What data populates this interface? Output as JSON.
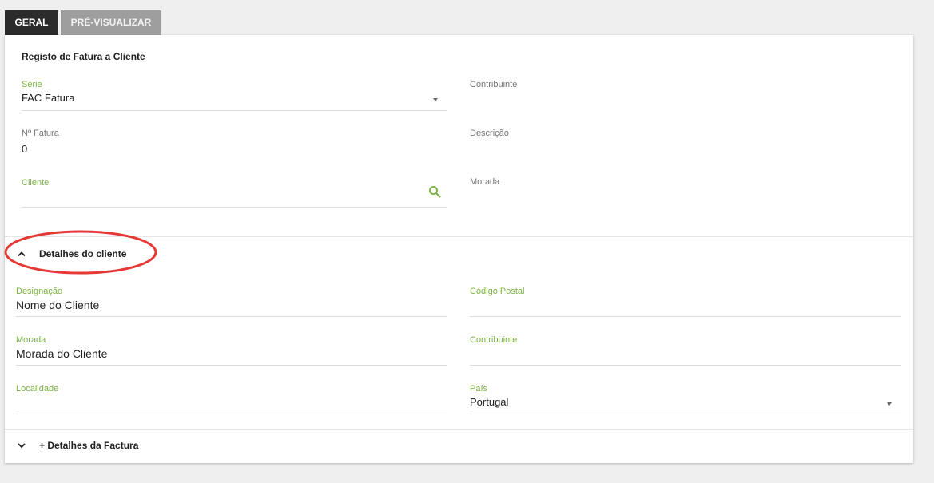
{
  "tabs": [
    {
      "label": "GERAL",
      "active": true
    },
    {
      "label": "PRÉ-VISUALIZAR",
      "active": false
    }
  ],
  "card": {
    "title": "Registo de Fatura a Cliente"
  },
  "form": {
    "serie": {
      "label": "Série",
      "value": "FAC Fatura"
    },
    "contribuinte": {
      "label": "Contribuinte",
      "value": ""
    },
    "numero": {
      "label": "Nº Fatura",
      "value": "0"
    },
    "descricao": {
      "label": "Descrição",
      "value": ""
    },
    "cliente": {
      "label": "Cliente",
      "value": "",
      "icon": "search-icon"
    },
    "morada": {
      "label": "Morada",
      "value": ""
    }
  },
  "client_details": {
    "title": "Detalhes do cliente",
    "expanded": true,
    "icon": "chevron-up-icon",
    "fields": {
      "designacao": {
        "label": "Designação",
        "value": "Nome do Cliente"
      },
      "codigo_postal": {
        "label": "Código Postal",
        "value": ""
      },
      "morada": {
        "label": "Morada",
        "value": "Morada do Cliente"
      },
      "contribuinte": {
        "label": "Contribuinte",
        "value": ""
      },
      "localidade": {
        "label": "Localidade",
        "value": ""
      },
      "pais": {
        "label": "País",
        "value": "Portugal"
      }
    }
  },
  "invoice_details": {
    "title": "+ Detalhes da Factura",
    "expanded": false,
    "icon": "chevron-down-icon"
  },
  "colors": {
    "accent": "#7cb342",
    "annotation": "#e53935",
    "tab_active": "#2b2b2b",
    "tab_inactive": "#9e9e9e"
  }
}
